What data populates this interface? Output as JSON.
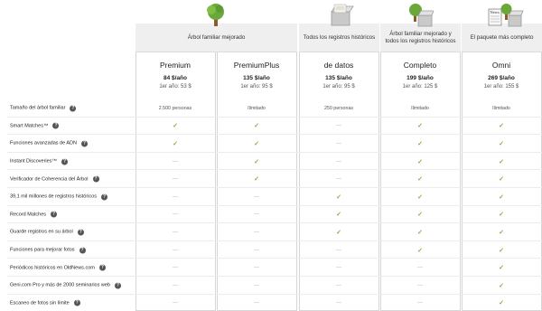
{
  "groups": [
    {
      "label": "Árbol familiar mejorado"
    },
    {
      "label": "Todos los registros históricos"
    },
    {
      "label": "Árbol familiar mejorado y todos los registros históricos"
    },
    {
      "label": "El paquete más completo"
    }
  ],
  "plans": [
    {
      "name": "Premium",
      "price": "84 $/año",
      "first_year": "1er año: 53 $"
    },
    {
      "name": "PremiumPlus",
      "price": "135 $/año",
      "first_year": "1er año: 95 $"
    },
    {
      "name": "de datos",
      "price": "135 $/año",
      "first_year": "1er año: 95 $"
    },
    {
      "name": "Completo",
      "price": "199 $/año",
      "first_year": "1er año: 125 $"
    },
    {
      "name": "Omni",
      "price": "269 $/año",
      "first_year": "1er año: 155 $"
    }
  ],
  "icons": [
    "tree-icon",
    "records-box-icon",
    "tree-and-box-icon",
    "newspaper-tree-box-icon"
  ],
  "help_glyph": "?",
  "check_glyph": "✓",
  "dash_glyph": "—",
  "colors": {
    "check": "#7cb342",
    "header_band": "#efefef",
    "border": "#d6d6d6"
  },
  "features": [
    {
      "label": "Tamaño del árbol familiar",
      "values": [
        "2.500 personas",
        "Ilimitado",
        "250 personas",
        "Ilimitado",
        "Ilimitado"
      ]
    },
    {
      "label": "Smart Matches™",
      "values": [
        "check",
        "check",
        "dash",
        "check",
        "check"
      ]
    },
    {
      "label": "Funciones avanzadas de ADN",
      "values": [
        "check",
        "check",
        "dash",
        "check",
        "check"
      ]
    },
    {
      "label": "Instant Discoveries™",
      "values": [
        "dash",
        "check",
        "dash",
        "check",
        "check"
      ]
    },
    {
      "label": "Verificador de Coherencia del Árbol",
      "values": [
        "dash",
        "check",
        "dash",
        "check",
        "check"
      ]
    },
    {
      "label": "39,1 mil millones de registros históricos",
      "values": [
        "dash",
        "dash",
        "check",
        "check",
        "check"
      ]
    },
    {
      "label": "Record Matches",
      "values": [
        "dash",
        "dash",
        "check",
        "check",
        "check"
      ]
    },
    {
      "label": "Guarde registros en su árbol",
      "values": [
        "dash",
        "dash",
        "check",
        "check",
        "check"
      ]
    },
    {
      "label": "Funciones para mejorar fotos",
      "values": [
        "dash",
        "dash",
        "dash",
        "check",
        "check"
      ]
    },
    {
      "label": "Periódicos históricos en OldNews.com",
      "values": [
        "dash",
        "dash",
        "dash",
        "dash",
        "check"
      ]
    },
    {
      "label": "Geni.com Pro y más de 2000 seminarios web",
      "values": [
        "dash",
        "dash",
        "dash",
        "dash",
        "check"
      ]
    },
    {
      "label": "Escaneo de fotos sin límite",
      "values": [
        "dash",
        "dash",
        "dash",
        "dash",
        "check"
      ]
    }
  ]
}
